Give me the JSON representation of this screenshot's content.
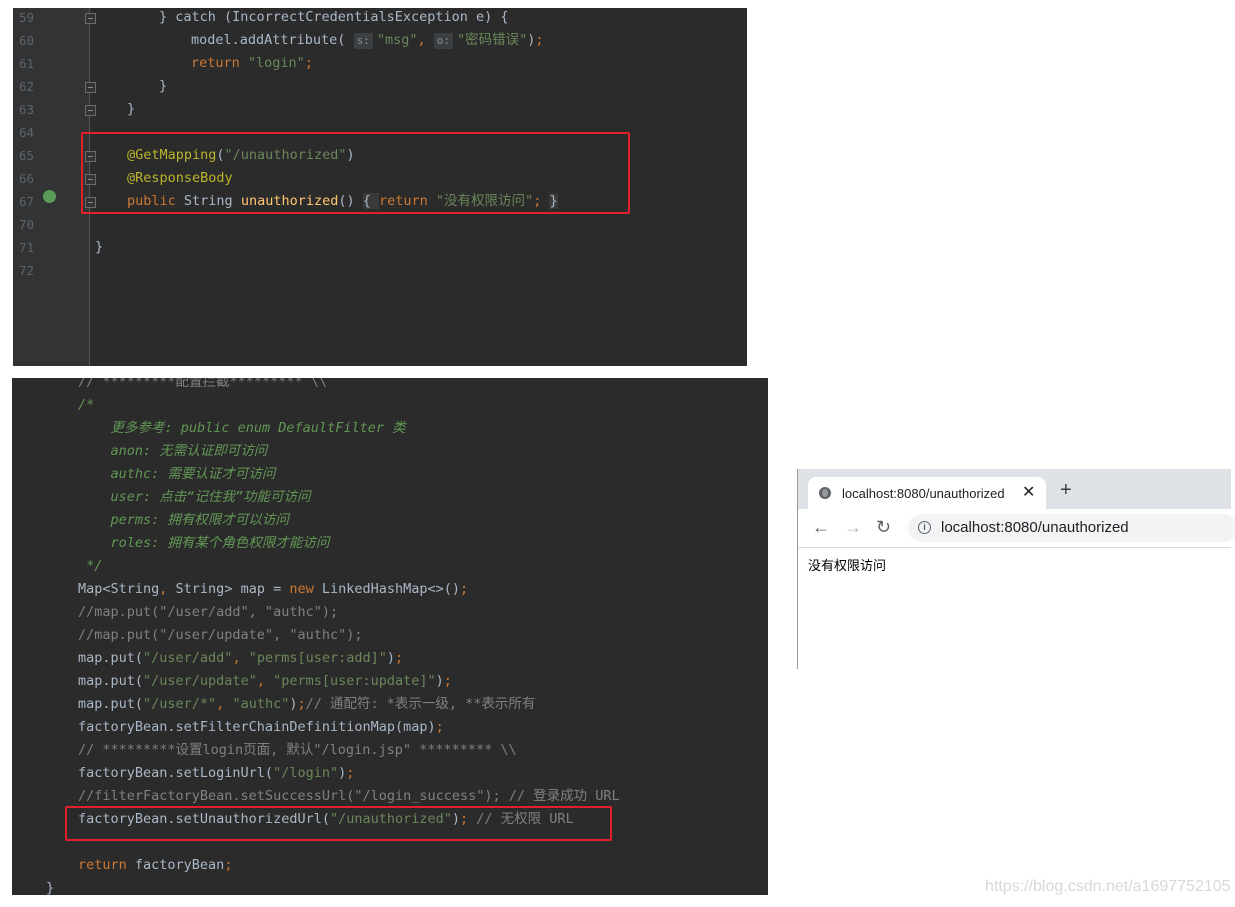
{
  "top_editor": {
    "lines": [
      {
        "num": "59",
        "tokens": [
          {
            "t": "} catch (IncorrectCredentialsException e) {",
            "c": "plain"
          }
        ]
      },
      {
        "num": "60",
        "tokens": [
          {
            "t": "model.addAttribute( ",
            "c": "plain"
          },
          {
            "t": "s:",
            "c": "chip"
          },
          {
            "t": "\"msg\"",
            "c": "str"
          },
          {
            "t": ", ",
            "c": "kw"
          },
          {
            "t": "o:",
            "c": "chip"
          },
          {
            "t": "\"密码错误\"",
            "c": "str"
          },
          {
            "t": ")",
            "c": "plain"
          },
          {
            "t": ";",
            "c": "kw"
          }
        ]
      },
      {
        "num": "61",
        "tokens": [
          {
            "t": "return ",
            "c": "kw"
          },
          {
            "t": "\"login\"",
            "c": "str"
          },
          {
            "t": ";",
            "c": "kw"
          }
        ]
      },
      {
        "num": "62",
        "tokens": [
          {
            "t": "}",
            "c": "plain"
          }
        ]
      },
      {
        "num": "63",
        "tokens": [
          {
            "t": "}",
            "c": "plain"
          }
        ]
      },
      {
        "num": "64",
        "tokens": []
      },
      {
        "num": "65",
        "tokens": [
          {
            "t": "@GetMapping",
            "c": "ann"
          },
          {
            "t": "(",
            "c": "plain"
          },
          {
            "t": "\"/unauthorized\"",
            "c": "str"
          },
          {
            "t": ")",
            "c": "plain"
          }
        ]
      },
      {
        "num": "66",
        "tokens": [
          {
            "t": "@ResponseBody",
            "c": "ann"
          }
        ]
      },
      {
        "num": "67",
        "tokens": [
          {
            "t": "public ",
            "c": "kw"
          },
          {
            "t": "String ",
            "c": "plain"
          },
          {
            "t": "unauthorized",
            "c": "fn"
          },
          {
            "t": "() ",
            "c": "plain"
          },
          {
            "t": "{ ",
            "c": "foldhint"
          },
          {
            "t": "return ",
            "c": "kw"
          },
          {
            "t": "\"没有权限访问\"",
            "c": "str"
          },
          {
            "t": "; ",
            "c": "kw"
          },
          {
            "t": "}",
            "c": "foldhint"
          }
        ]
      },
      {
        "num": "70",
        "tokens": []
      },
      {
        "num": "71",
        "tokens": [
          {
            "t": "}",
            "c": "plain"
          }
        ]
      },
      {
        "num": "72",
        "tokens": []
      }
    ]
  },
  "bottom_editor": {
    "lines": [
      {
        "tokens": [
          {
            "t": "// *********配置拦截********* \\\\",
            "c": "lcmt"
          }
        ]
      },
      {
        "tokens": [
          {
            "t": "/*",
            "c": "cmt"
          }
        ]
      },
      {
        "tokens": [
          {
            "t": "    更多参考: public enum DefaultFilter 类",
            "c": "cmt"
          }
        ]
      },
      {
        "tokens": [
          {
            "t": "    anon: 无需认证即可访问",
            "c": "cmt"
          }
        ]
      },
      {
        "tokens": [
          {
            "t": "    authc: 需要认证才可访问",
            "c": "cmt"
          }
        ]
      },
      {
        "tokens": [
          {
            "t": "    user: 点击“记住我”功能可访问",
            "c": "cmt"
          }
        ]
      },
      {
        "tokens": [
          {
            "t": "    perms: 拥有权限才可以访问",
            "c": "cmt"
          }
        ]
      },
      {
        "tokens": [
          {
            "t": "    roles: 拥有某个角色权限才能访问",
            "c": "cmt"
          }
        ]
      },
      {
        "tokens": [
          {
            "t": " */",
            "c": "cmt"
          }
        ]
      },
      {
        "tokens": [
          {
            "t": "Map<String",
            "c": "plain"
          },
          {
            "t": ", ",
            "c": "kw"
          },
          {
            "t": "String> map = ",
            "c": "plain"
          },
          {
            "t": "new ",
            "c": "kw"
          },
          {
            "t": "LinkedHashMap<>()",
            "c": "plain"
          },
          {
            "t": ";",
            "c": "kw"
          }
        ]
      },
      {
        "tokens": [
          {
            "t": "//map.put(\"/user/add\", \"authc\");",
            "c": "lcmt"
          }
        ]
      },
      {
        "tokens": [
          {
            "t": "//map.put(\"/user/update\", \"authc\");",
            "c": "lcmt"
          }
        ]
      },
      {
        "tokens": [
          {
            "t": "map.put(",
            "c": "plain"
          },
          {
            "t": "\"/user/add\"",
            "c": "str"
          },
          {
            "t": ", ",
            "c": "kw"
          },
          {
            "t": "\"perms[user:add]\"",
            "c": "str"
          },
          {
            "t": ")",
            "c": "plain"
          },
          {
            "t": ";",
            "c": "kw"
          }
        ]
      },
      {
        "tokens": [
          {
            "t": "map.put(",
            "c": "plain"
          },
          {
            "t": "\"/user/update\"",
            "c": "str"
          },
          {
            "t": ", ",
            "c": "kw"
          },
          {
            "t": "\"perms[user:update]\"",
            "c": "str"
          },
          {
            "t": ")",
            "c": "plain"
          },
          {
            "t": ";",
            "c": "kw"
          }
        ]
      },
      {
        "tokens": [
          {
            "t": "map.put(",
            "c": "plain"
          },
          {
            "t": "\"/user/*\"",
            "c": "str"
          },
          {
            "t": ", ",
            "c": "kw"
          },
          {
            "t": "\"authc\"",
            "c": "str"
          },
          {
            "t": ")",
            "c": "plain"
          },
          {
            "t": ";",
            "c": "kw"
          },
          {
            "t": "// 通配符: *表示一级, **表示所有",
            "c": "lcmt"
          }
        ]
      },
      {
        "tokens": [
          {
            "t": "factoryBean.setFilterChainDefinitionMap(map)",
            "c": "plain"
          },
          {
            "t": ";",
            "c": "kw"
          }
        ]
      },
      {
        "tokens": [
          {
            "t": "// *********设置login页面, 默认\"/login.jsp\" ********* \\\\",
            "c": "lcmt"
          }
        ]
      },
      {
        "tokens": [
          {
            "t": "factoryBean.setLoginUrl(",
            "c": "plain"
          },
          {
            "t": "\"/login\"",
            "c": "str"
          },
          {
            "t": ")",
            "c": "plain"
          },
          {
            "t": ";",
            "c": "kw"
          }
        ]
      },
      {
        "tokens": [
          {
            "t": "//filterFactoryBean.setSuccessUrl(\"/login_success\"); // 登录成功 URL",
            "c": "lcmt"
          }
        ]
      },
      {
        "tokens": [
          {
            "t": "factoryBean.setUnauthorizedUrl(",
            "c": "plain"
          },
          {
            "t": "\"/unauthorized\"",
            "c": "str"
          },
          {
            "t": ")",
            "c": "plain"
          },
          {
            "t": "; ",
            "c": "kw"
          },
          {
            "t": "// 无权限 URL",
            "c": "lcmt"
          }
        ]
      },
      {
        "tokens": []
      },
      {
        "tokens": [
          {
            "t": "return ",
            "c": "kw"
          },
          {
            "t": "factoryBean",
            "c": "plain"
          },
          {
            "t": ";",
            "c": "kw"
          }
        ]
      },
      {
        "tokens": [
          {
            "t": "}",
            "c": "plain"
          }
        ]
      }
    ]
  },
  "browser": {
    "tab_title": "localhost:8080/unauthorized",
    "tab_close": "✕",
    "new_tab": "+",
    "back": "←",
    "forward": "→",
    "reload": "↻",
    "info": "i",
    "url": "localhost:8080/unauthorized",
    "page_text": "没有权限访问"
  },
  "watermark": "https://blog.csdn.net/a1697752105",
  "colors": {
    "editor_bg": "#2b2b2b",
    "keyword": "#cc7832",
    "string": "#6a8759",
    "annotation": "#bbb529",
    "highlight_box": "#e0202a"
  }
}
